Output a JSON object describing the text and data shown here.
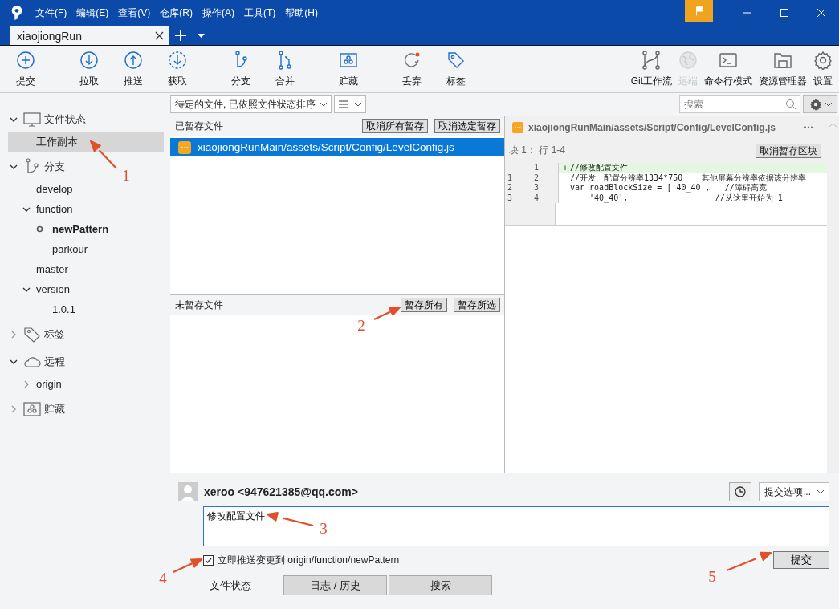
{
  "menu": [
    "文件(F)",
    "编辑(E)",
    "查看(V)",
    "仓库(R)",
    "操作(A)",
    "工具(T)",
    "帮助(H)"
  ],
  "tabs": [
    {
      "label": "xiaojiongRun",
      "selected": true
    }
  ],
  "toolbar": {
    "groups": [
      [
        {
          "label": "提交"
        }
      ],
      [
        {
          "label": "拉取"
        },
        {
          "label": "推送"
        },
        {
          "label": "获取"
        }
      ],
      [
        {
          "label": "分支"
        },
        {
          "label": "合并"
        }
      ],
      [
        {
          "label": "贮藏"
        }
      ],
      [
        {
          "label": "丢弃"
        },
        {
          "label": "标签"
        }
      ]
    ],
    "right": [
      {
        "label": "Git工作流",
        "disabled": false
      },
      {
        "label": "远端",
        "disabled": true
      },
      {
        "label": "命令行模式",
        "disabled": false
      },
      {
        "label": "资源管理器",
        "disabled": false
      },
      {
        "label": "设置",
        "disabled": false
      }
    ]
  },
  "sidebar": [
    {
      "label": "文件状态",
      "expanded": true,
      "selected": false,
      "children": [
        {
          "label": "工作副本",
          "selected": true,
          "current": false
        }
      ]
    },
    {
      "label": "分支",
      "expanded": true,
      "selected": false,
      "children": [
        {
          "label": "develop",
          "selected": false,
          "current": false
        },
        {
          "label": "function",
          "expanded": true,
          "selected": false,
          "current": false,
          "children": [
            {
              "label": "newPattern",
              "selected": false,
              "current": true
            },
            {
              "label": "parkour",
              "selected": false,
              "current": false
            }
          ]
        },
        {
          "label": "master",
          "selected": false,
          "current": false
        },
        {
          "label": "version",
          "expanded": true,
          "selected": false,
          "current": false,
          "children": [
            {
              "label": "1.0.1",
              "selected": false,
              "current": false
            }
          ]
        }
      ]
    },
    {
      "label": "标签",
      "expanded": false,
      "selected": false
    },
    {
      "label": "远程",
      "expanded": true,
      "selected": false,
      "children": [
        {
          "label": "origin",
          "expanded": false,
          "selected": false,
          "current": false
        }
      ]
    },
    {
      "label": "贮藏",
      "expanded": false,
      "selected": false
    }
  ],
  "filter": {
    "value": "待定的文件, 已依照文件状态排序"
  },
  "search": {
    "placeholder": "搜索"
  },
  "staged": {
    "title": "已暂存文件",
    "buttons": [
      "取消所有暂存",
      "取消选定暂存"
    ],
    "files": [
      {
        "path": "xiaojiongRunMain/assets/Script/Config/LevelConfig.js",
        "selected": true
      }
    ]
  },
  "unstaged": {
    "title": "未暂存文件",
    "buttons": [
      "暂存所有",
      "暂存所选"
    ]
  },
  "diff": {
    "file": "xiaojiongRunMain/assets/Script/Config/LevelConfig.js",
    "hunk": "块 1： 行 1-4",
    "button": "取消暂存区块",
    "lines": [
      {
        "new": "1",
        "marker": "+",
        "text": "//修改配置文件",
        "kind": "added"
      },
      {
        "old": "1",
        "new": "2",
        "text": "//开发、配置分辨率1334*750    其他屏幕分辨率依据该分辨率",
        "kind": "context"
      },
      {
        "old": "2",
        "new": "3",
        "text": "var roadBlockSize = ['40_40',   //障碍高宽",
        "kind": "context"
      },
      {
        "old": "3",
        "new": "4",
        "text": "    '40_40',                  //从这里开始为 1",
        "kind": "context"
      }
    ]
  },
  "commit": {
    "author": "xeroo <947621385@qq.com>",
    "options": "提交选项...",
    "message": "修改配置文件",
    "push": {
      "label": "立即推送变更到 origin/function/newPattern",
      "checked": true
    },
    "button": "提交"
  },
  "bottom_tabs": [
    {
      "label": "文件状态",
      "selected": true
    },
    {
      "label": "日志 / 历史",
      "selected": false
    },
    {
      "label": "搜索",
      "selected": false
    }
  ],
  "annotations": [
    {
      "label": "1"
    },
    {
      "label": "2"
    },
    {
      "label": "3"
    },
    {
      "label": "4"
    },
    {
      "label": "5"
    }
  ]
}
